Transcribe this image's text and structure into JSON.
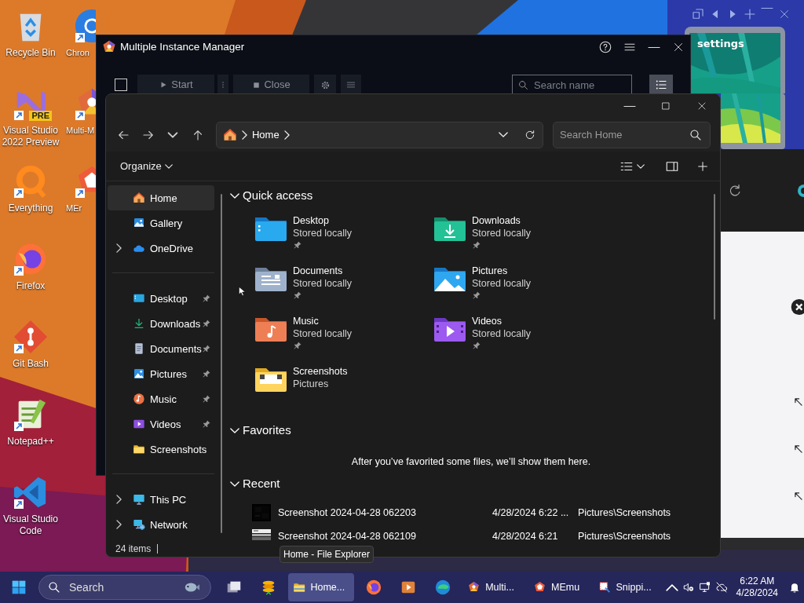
{
  "desktop_icons": [
    {
      "label": "Recycle Bin",
      "kind": "recycle",
      "shortcut": false
    },
    {
      "label": "Visual Studio 2022 Preview",
      "kind": "vspreview",
      "shortcut": true,
      "badge": "PRE"
    },
    {
      "label": "Everything",
      "kind": "everything",
      "shortcut": true
    },
    {
      "label": "Firefox",
      "kind": "firefox",
      "shortcut": true
    },
    {
      "label": "Git Bash",
      "kind": "git",
      "shortcut": true
    },
    {
      "label": "Notepad++",
      "kind": "notepad",
      "shortcut": true
    },
    {
      "label": "Visual Studio Code",
      "kind": "vscode",
      "shortcut": true
    }
  ],
  "desktop_icons_column_2": [
    {
      "label": "Chron",
      "kind": "chrome",
      "shortcut": true
    },
    {
      "label": "Multi-M",
      "kind": "multi",
      "shortcut": true
    },
    {
      "label": "MEr",
      "kind": "memu",
      "shortcut": true
    }
  ],
  "memu_panel": {
    "widget_title": "settings"
  },
  "multi_instance_manager": {
    "title": "Multiple Instance Manager",
    "select_all_checked": false,
    "start_button": "Start",
    "close_button": "Close",
    "search_placeholder": "Search name"
  },
  "file_explorer": {
    "breadcrumb": [
      "Home"
    ],
    "search_placeholder": "Search Home",
    "organize": "Organize",
    "nav_sections": [
      {
        "items": [
          {
            "label": "Home",
            "kind": "home",
            "selected": true,
            "expandable": false,
            "pinned": false
          },
          {
            "label": "Gallery",
            "kind": "gallery",
            "selected": false,
            "expandable": false,
            "pinned": false
          },
          {
            "label": "OneDrive",
            "kind": "onedrive",
            "selected": false,
            "expandable": true,
            "pinned": false
          }
        ]
      },
      {
        "items": [
          {
            "label": "Desktop",
            "kind": "desktop",
            "selected": false,
            "expandable": false,
            "pinned": true
          },
          {
            "label": "Downloads",
            "kind": "downloads",
            "selected": false,
            "expandable": false,
            "pinned": true
          },
          {
            "label": "Documents",
            "kind": "documents",
            "selected": false,
            "expandable": false,
            "pinned": true
          },
          {
            "label": "Pictures",
            "kind": "pictures",
            "selected": false,
            "expandable": false,
            "pinned": true
          },
          {
            "label": "Music",
            "kind": "music",
            "selected": false,
            "expandable": false,
            "pinned": true
          },
          {
            "label": "Videos",
            "kind": "videos",
            "selected": false,
            "expandable": false,
            "pinned": true
          },
          {
            "label": "Screenshots",
            "kind": "folder",
            "selected": false,
            "expandable": false,
            "pinned": false
          }
        ]
      },
      {
        "items": [
          {
            "label": "This PC",
            "kind": "thispc",
            "selected": false,
            "expandable": true,
            "pinned": false
          },
          {
            "label": "Network",
            "kind": "network",
            "selected": false,
            "expandable": true,
            "pinned": false
          }
        ]
      }
    ],
    "quick_access": {
      "heading": "Quick access",
      "expanded": true,
      "items": [
        {
          "name": "Desktop",
          "location": "Stored locally",
          "kind": "desktop",
          "pinned": true
        },
        {
          "name": "Downloads",
          "location": "Stored locally",
          "kind": "downloads",
          "pinned": true
        },
        {
          "name": "Documents",
          "location": "Stored locally",
          "kind": "documents",
          "pinned": true
        },
        {
          "name": "Pictures",
          "location": "Stored locally",
          "kind": "pictures",
          "pinned": true
        },
        {
          "name": "Music",
          "location": "Stored locally",
          "kind": "music",
          "pinned": true
        },
        {
          "name": "Videos",
          "location": "Stored locally",
          "kind": "videos",
          "pinned": true
        },
        {
          "name": "Screenshots",
          "location": "Pictures",
          "kind": "screenshots",
          "pinned": false
        }
      ]
    },
    "favorites": {
      "heading": "Favorites",
      "expanded": true,
      "empty_message": "After you’ve favorited some files, we’ll show them here."
    },
    "recent": {
      "heading": "Recent",
      "expanded": true,
      "files": [
        {
          "name": "Screenshot 2024-04-28 062203",
          "date": "4/28/2024 6:22 ...",
          "location": "Pictures\\Screenshots",
          "kind": "dark"
        },
        {
          "name": "Screenshot 2024-04-28 062109",
          "date": "4/28/2024 6:21",
          "location": "Pictures\\Screenshots",
          "kind": "light"
        }
      ]
    },
    "status": "24 items"
  },
  "tooltip": "Home - File Explorer",
  "taskbar": {
    "search_placeholder": "Search",
    "apps": [
      {
        "kind": "taskview",
        "selected": false,
        "running": false
      },
      {
        "kind": "stack",
        "selected": false,
        "running": false
      },
      {
        "kind": "explorer",
        "label": "Home...",
        "selected": true,
        "running": true
      },
      {
        "kind": "firefox",
        "selected": false,
        "running": false
      },
      {
        "kind": "media",
        "selected": false,
        "running": false
      },
      {
        "kind": "edge",
        "selected": false,
        "running": false
      },
      {
        "kind": "multi",
        "label": "Multi...",
        "selected": false,
        "running": true
      },
      {
        "kind": "memu",
        "label": "MEmu",
        "selected": false,
        "running": true
      },
      {
        "kind": "snip",
        "label": "Snippi...",
        "selected": false,
        "running": true
      }
    ],
    "time": "6:22 AM",
    "date": "4/28/2024"
  }
}
